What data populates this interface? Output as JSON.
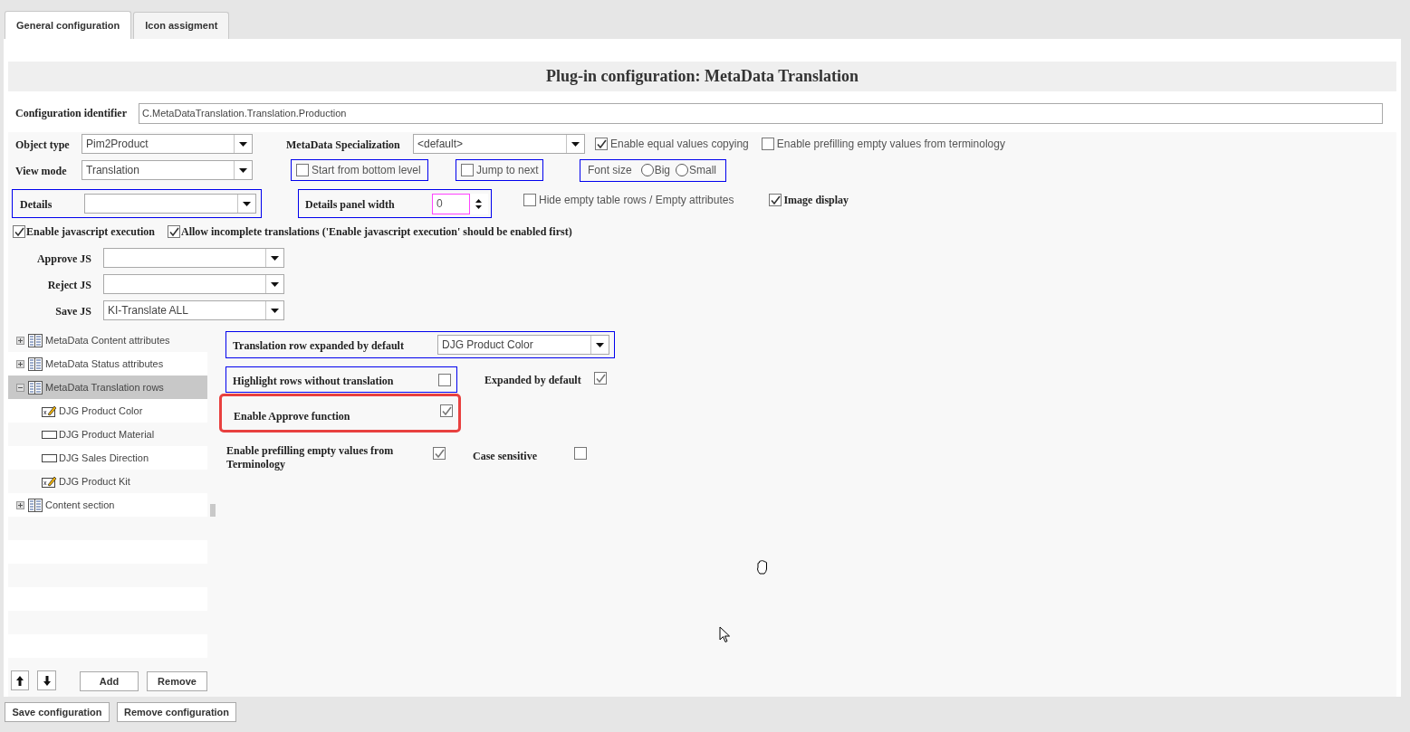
{
  "tabs": [
    {
      "label": "General configuration",
      "selected": true
    },
    {
      "label": "Icon assigment",
      "selected": false
    }
  ],
  "title": "Plug-in configuration: MetaData Translation",
  "config_identifier": {
    "label": "Configuration identifier",
    "value": "C.MetaDataTranslation.Translation.Production"
  },
  "object_type": {
    "label": "Object type",
    "value": "Pim2Product"
  },
  "metadata_specialization": {
    "label": "MetaData Specialization",
    "value": "<default>"
  },
  "enable_equal_values_copying": {
    "label": "Enable equal values copying",
    "checked": true
  },
  "enable_prefilling_from_terminology": {
    "label": "Enable prefilling empty values from terminology",
    "checked": false
  },
  "view_mode": {
    "label": "View mode",
    "value": "Translation"
  },
  "start_from_bottom_level": {
    "label": "Start from bottom level",
    "checked": false
  },
  "jump_to_next": {
    "label": "Jump to next",
    "checked": false
  },
  "font_size": {
    "label": "Font size",
    "options": [
      {
        "label": "Big",
        "selected": false
      },
      {
        "label": "Small",
        "selected": false
      }
    ]
  },
  "details": {
    "label": "Details"
  },
  "details_panel_width": {
    "label": "Details panel width",
    "value": "0"
  },
  "hide_empty": {
    "label": "Hide empty table rows / Empty attributes",
    "checked": false
  },
  "image_display": {
    "label": "Image display",
    "checked": true
  },
  "enable_javascript": {
    "label": "Enable javascript execution",
    "checked": true
  },
  "allow_incomplete": {
    "label": "Allow incomplete translations ('Enable javascript execution' should be enabled first)",
    "checked": true
  },
  "js_fields": [
    {
      "label": "Approve JS"
    },
    {
      "label": "Reject JS"
    },
    {
      "label": "Save JS",
      "value": "KI-Translate ALL"
    }
  ],
  "tree": [
    {
      "label": "MetaData Content attributes",
      "expanded": false,
      "selected": false
    },
    {
      "label": "MetaData Status attributes",
      "expanded": false,
      "selected": false
    },
    {
      "label": "MetaData Translation rows",
      "expanded": true,
      "selected": true,
      "children": [
        {
          "label": "DJG Product Color",
          "kind": "edited",
          "selected": false
        },
        {
          "label": "DJG Product Material",
          "kind": "plain",
          "selected": false
        },
        {
          "label": "DJG Sales Direction",
          "kind": "plain",
          "selected": false
        },
        {
          "label": "DJG Product Kit",
          "kind": "edited",
          "selected": false
        }
      ]
    },
    {
      "label": "Content section",
      "expanded": false,
      "selected": false
    }
  ],
  "list_buttons": [
    "Add",
    "Remove"
  ],
  "translation_row_expanded": {
    "label": "Translation row expanded by default",
    "value": "DJG Product Color"
  },
  "highlight_rows": {
    "label": "Highlight rows without translation",
    "checked": false
  },
  "expanded_by_default": {
    "label": "Expanded by default",
    "checked": true
  },
  "enable_approve": {
    "label": "Enable Approve function",
    "checked": true,
    "highlighted": true
  },
  "enable_prefilling_terminology": {
    "label": "Enable prefilling empty values from Terminology",
    "checked": true
  },
  "case_sensitive": {
    "label": "Case sensitive",
    "checked": false
  },
  "footer_buttons": [
    "Save configuration",
    "Remove configuration"
  ]
}
